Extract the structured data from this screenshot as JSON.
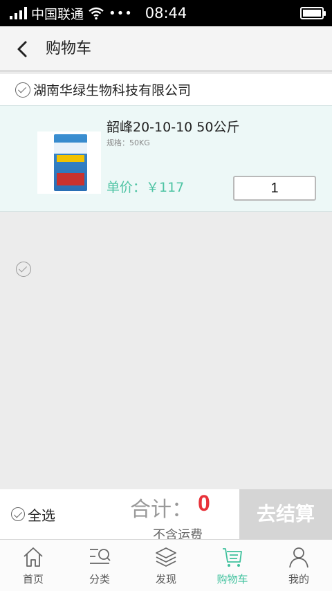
{
  "status_bar": {
    "carrier": "中国联通",
    "time": "08:44",
    "icons": [
      "signal-icon",
      "wifi-icon",
      "more-dots-icon",
      "battery-icon"
    ]
  },
  "header": {
    "title": "购物车",
    "back_icon": "chevron-left-icon"
  },
  "shop": {
    "name": "湖南华绿生物科技有限公司"
  },
  "cart_items": [
    {
      "name": "韶峰20-10-10 50公斤",
      "spec": "规格：50KG",
      "price": "单价：￥117",
      "quantity": "1"
    }
  ],
  "checkout": {
    "select_all": "全选",
    "total_label": "合计：",
    "total_value": "0",
    "shipping_note": "不含运费",
    "pay_button": "去结算"
  },
  "tabbar": {
    "tabs": [
      {
        "label": "首页",
        "icon": "home-icon",
        "active": false
      },
      {
        "label": "分类",
        "icon": "category-search-icon",
        "active": false
      },
      {
        "label": "发现",
        "icon": "layers-icon",
        "active": false
      },
      {
        "label": "购物车",
        "icon": "cart-icon",
        "active": true
      },
      {
        "label": "我的",
        "icon": "user-icon",
        "active": false
      }
    ]
  },
  "colors": {
    "accent": "#3fc19d",
    "price": "#4dc3a3",
    "total": "#e8323a",
    "pay_button_disabled": "#d5d5d5"
  }
}
